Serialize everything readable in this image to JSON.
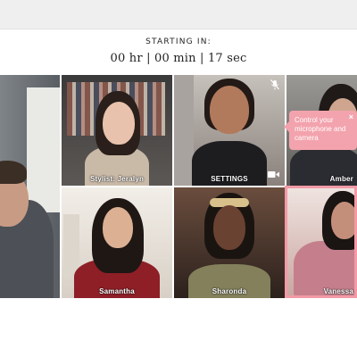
{
  "countdown": {
    "label": "STARTING IN:",
    "timer": "00 hr | 00 min | 17 sec"
  },
  "tiles": {
    "stylist": "Stylist: Jeralyn",
    "settings": "SETTINGS",
    "amber": "Amber",
    "samantha": "Samantha",
    "sharonda": "Sharonda",
    "vanessa": "Vanessa"
  },
  "tooltip": {
    "text": "Control your microphone and camera",
    "close_glyph": "×"
  },
  "icons": {
    "mic_muted": "mic-muted-icon",
    "camera": "camera-icon",
    "close": "close-icon"
  },
  "colors": {
    "accent": "#f29aa6",
    "tooltip_bg": "#f3a3ad",
    "topbar": "#efefef"
  }
}
